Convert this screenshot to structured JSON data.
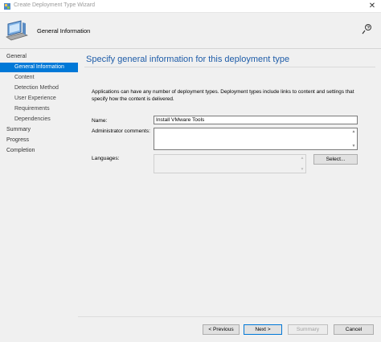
{
  "window": {
    "title": "Create Deployment Type Wizard",
    "close_glyph": "✕"
  },
  "header": {
    "title": "General Information",
    "icon": "computer-icon",
    "help_icon": "help-icon"
  },
  "nav": {
    "items": [
      {
        "label": "General",
        "level": 0,
        "active": false
      },
      {
        "label": "General Information",
        "level": 1,
        "active": true
      },
      {
        "label": "Content",
        "level": 1,
        "active": false
      },
      {
        "label": "Detection Method",
        "level": 1,
        "active": false
      },
      {
        "label": "User Experience",
        "level": 1,
        "active": false
      },
      {
        "label": "Requirements",
        "level": 1,
        "active": false
      },
      {
        "label": "Dependencies",
        "level": 1,
        "active": false
      },
      {
        "label": "Summary",
        "level": 0,
        "active": false
      },
      {
        "label": "Progress",
        "level": 0,
        "active": false
      },
      {
        "label": "Completion",
        "level": 0,
        "active": false
      }
    ]
  },
  "main": {
    "page_title": "Specify general information for this deployment type",
    "description": "Applications can have any number of deployment types. Deployment types include links to content and settings that specify how the content is delivered.",
    "name_label": "Name:",
    "name_value": "Install VMware Tools",
    "comments_label": "Administrator comments:",
    "comments_value": "",
    "languages_label": "Languages:",
    "languages_value": "",
    "select_button": "Select..."
  },
  "footer": {
    "previous": "< Previous",
    "next": "Next >",
    "summary": "Summary",
    "cancel": "Cancel"
  },
  "colors": {
    "accent": "#0078d7",
    "title_blue": "#1e5ca8",
    "panel_bg": "#f0f0f0"
  }
}
